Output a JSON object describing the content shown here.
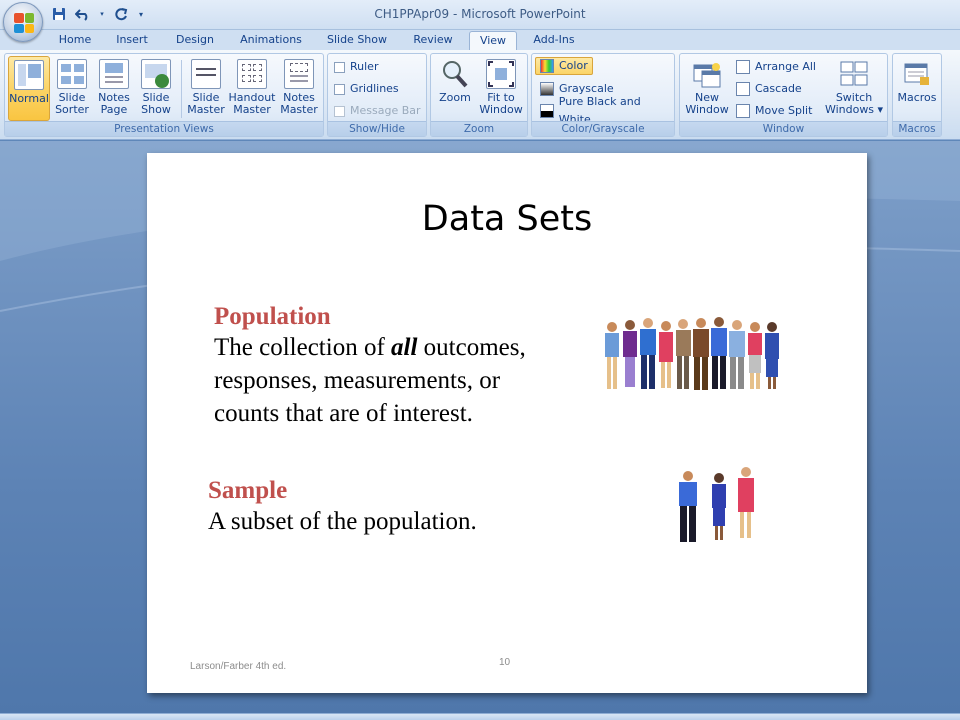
{
  "window": {
    "title": "CH1PPApr09 - Microsoft PowerPoint"
  },
  "tabs": [
    {
      "label": "Home"
    },
    {
      "label": "Insert"
    },
    {
      "label": "Design"
    },
    {
      "label": "Animations"
    },
    {
      "label": "Slide Show"
    },
    {
      "label": "Review"
    },
    {
      "label": "View"
    },
    {
      "label": "Add-Ins"
    }
  ],
  "ribbon": {
    "presentation_views": {
      "label": "Presentation Views",
      "buttons": [
        {
          "line1": "Normal",
          "line2": ""
        },
        {
          "line1": "Slide",
          "line2": "Sorter"
        },
        {
          "line1": "Notes",
          "line2": "Page"
        },
        {
          "line1": "Slide",
          "line2": "Show"
        },
        {
          "line1": "Slide",
          "line2": "Master"
        },
        {
          "line1": "Handout",
          "line2": "Master"
        },
        {
          "line1": "Notes",
          "line2": "Master"
        }
      ]
    },
    "show_hide": {
      "label": "Show/Hide",
      "items": [
        {
          "label": "Ruler"
        },
        {
          "label": "Gridlines"
        },
        {
          "label": "Message Bar"
        }
      ]
    },
    "zoom": {
      "label": "Zoom",
      "buttons": [
        {
          "line1": "Zoom",
          "line2": ""
        },
        {
          "line1": "Fit to",
          "line2": "Window"
        }
      ]
    },
    "color": {
      "label": "Color/Grayscale",
      "items": [
        {
          "label": "Color"
        },
        {
          "label": "Grayscale"
        },
        {
          "label": "Pure Black and White"
        }
      ]
    },
    "window": {
      "label": "Window",
      "new_window": {
        "line1": "New",
        "line2": "Window"
      },
      "items": [
        {
          "label": "Arrange All"
        },
        {
          "label": "Cascade"
        },
        {
          "label": "Move Split"
        }
      ],
      "switch": {
        "line1": "Switch",
        "line2": "Windows ▾"
      }
    },
    "macros": {
      "label": "Macros",
      "button": {
        "line1": "Macros"
      }
    }
  },
  "slide": {
    "title": "Data Sets",
    "population_heading": "Population",
    "population_pre": "The collection of ",
    "population_emph": "all",
    "population_line1_post": " outcomes,",
    "population_line2": "responses, measurements, or",
    "population_line3": "counts that are of interest.",
    "sample_heading": "Sample",
    "sample_text": "A subset of the population.",
    "footer_left": "Larson/Farber 4th ed.",
    "page_number": "10"
  },
  "colors": {
    "heading_red": "#c0504d",
    "ribbon_label": "#15428b",
    "workspace_blue": "#5d83b5"
  }
}
